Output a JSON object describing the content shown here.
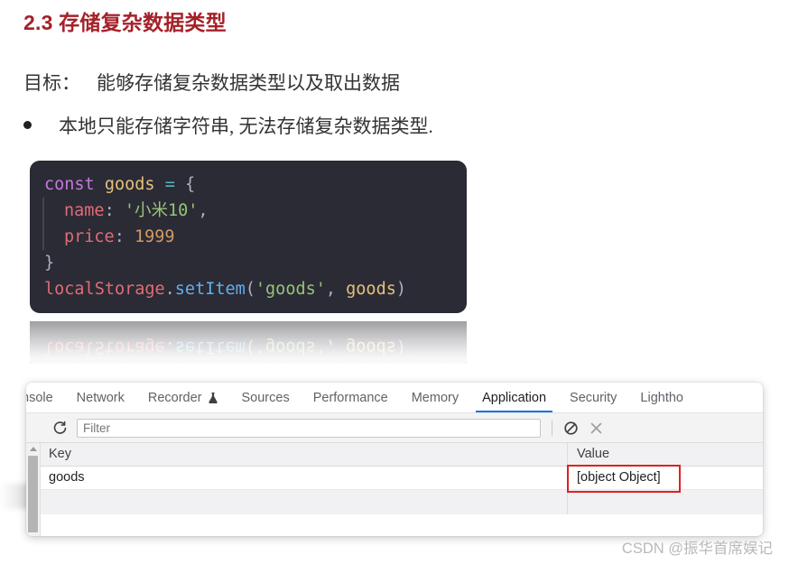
{
  "document": {
    "heading": "2.3 存储复杂数据类型",
    "goal_label": "目标：",
    "goal_text": "能够存储复杂数据类型以及取出数据",
    "bullet_text": "本地只能存储字符串, 无法存储复杂数据类型."
  },
  "code": {
    "line1": {
      "kw": "const",
      "space1": " ",
      "var": "goods",
      "space2": " ",
      "op": "=",
      "space3": " ",
      "brace": "{"
    },
    "line2": {
      "prop": "name",
      "colon": ": ",
      "str": "'小米10'",
      "comma": ","
    },
    "line3": {
      "prop": "price",
      "colon": ": ",
      "num": "1999"
    },
    "line4": {
      "brace": "}"
    },
    "line5": {
      "obj": "localStorage",
      "dot": ".",
      "fn": "setItem",
      "paren_open": "(",
      "arg1": "'goods'",
      "comma": ", ",
      "arg2": "goods",
      "paren_close": ")"
    }
  },
  "devtools": {
    "tabs": [
      {
        "label": "nsole",
        "icon": "",
        "active": false
      },
      {
        "label": "Network",
        "icon": "",
        "active": false
      },
      {
        "label": "Recorder",
        "icon": "flask-icon",
        "active": false
      },
      {
        "label": "Sources",
        "icon": "",
        "active": false
      },
      {
        "label": "Performance",
        "icon": "",
        "active": false
      },
      {
        "label": "Memory",
        "icon": "",
        "active": false
      },
      {
        "label": "Application",
        "icon": "",
        "active": true
      },
      {
        "label": "Security",
        "icon": "",
        "active": false
      },
      {
        "label": "Lightho",
        "icon": "",
        "active": false
      }
    ],
    "toolbar": {
      "refresh_icon": "refresh-icon",
      "filter_placeholder": "Filter",
      "filter_value": "",
      "clear_all_icon": "clear-all-icon",
      "delete_selected_icon": "delete-selected-icon"
    },
    "table": {
      "columns": [
        "Key",
        "Value"
      ],
      "rows": [
        {
          "key": "goods",
          "value": "[object Object]"
        }
      ]
    },
    "highlight_color": "#e02020",
    "active_tab_color": "#1a73e8"
  },
  "watermark": {
    "text": "CSDN @振华首席娱记"
  }
}
